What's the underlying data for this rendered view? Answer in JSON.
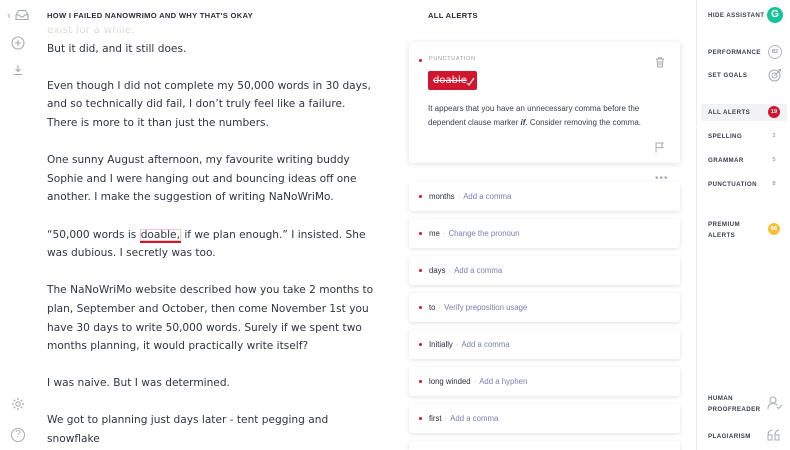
{
  "rail": {
    "back_glyph": "‹",
    "icons": [
      "chevron-left-icon",
      "inbox-icon",
      "plus-circle-icon",
      "download-icon",
      "gear-icon",
      "help-icon"
    ]
  },
  "document": {
    "title": "HOW I FAILED NANOWRIMO AND WHY THAT'S OKAY",
    "faded_line": "exist for a while.",
    "paragraphs": {
      "p1": "But it did, and it still does.",
      "p2": "Even though I did not complete my 50,000 words in 30 days, and so technically did fail, I don’t truly feel like a failure. There is more to it than just the numbers.",
      "p3": "One sunny August afternoon, my favourite writing buddy Sophie and I were hanging out and bouncing ideas off one another. I make the suggestion of writing NaNoWriMo.",
      "p4_before": "“50,000 words is ",
      "p4_flagged": "doable,",
      "p4_after": " if we plan enough.” I insisted. She was dubious. I secretly was too.",
      "p5": "The NaNoWriMo website described how you take 2 months to plan, September and October, then come November 1st you have 30 days to write 50,000 words. Surely if we spent two months planning, it would practically write itself?",
      "p6": "I was naive. But I was determined.",
      "p7": "We got to planning just days later - tent pegging and snowflake"
    }
  },
  "alerts": {
    "title": "ALL ALERTS",
    "main_card": {
      "category": "PUNCTUATION",
      "flagged_word": "doable",
      "explanation_before": "It appears that you have an unnecessary comma before the dependent clause marker ",
      "explanation_em": "if",
      "explanation_after": ". Consider removing the comma.",
      "more": "•••"
    },
    "separator": "·",
    "items": [
      {
        "word": "months",
        "suggestion": "Add a comma"
      },
      {
        "word": "me",
        "suggestion": "Change the pronoun"
      },
      {
        "word": "days",
        "suggestion": "Add a comma"
      },
      {
        "word": "to",
        "suggestion": "Verify preposition usage"
      },
      {
        "word": "Initially",
        "suggestion": "Add a comma"
      },
      {
        "word": "long winded",
        "suggestion": "Add a hyphen"
      },
      {
        "word": "first",
        "suggestion": "Add a comma"
      }
    ],
    "accent_color": "#d0162e"
  },
  "sidebar": {
    "hide_assistant": "HIDE ASSISTANT",
    "logo_letter": "G",
    "performance": "PERFORMANCE",
    "performance_score": "82",
    "set_goals": "SET GOALS",
    "all_alerts": "ALL ALERTS",
    "all_alerts_count": "19",
    "spelling": "SPELLING",
    "spelling_count": "2",
    "grammar": "GRAMMAR",
    "grammar_count": "5",
    "punctuation": "PUNCTUATION",
    "punctuation_count": "8",
    "premium_line1": "PREMIUM",
    "premium_line2": "ALERTS",
    "premium_count": "66",
    "human_line1": "HUMAN",
    "human_line2": "PROOFREADER",
    "plagiarism": "PLAGIARISM",
    "brand_color": "#15c39a"
  }
}
